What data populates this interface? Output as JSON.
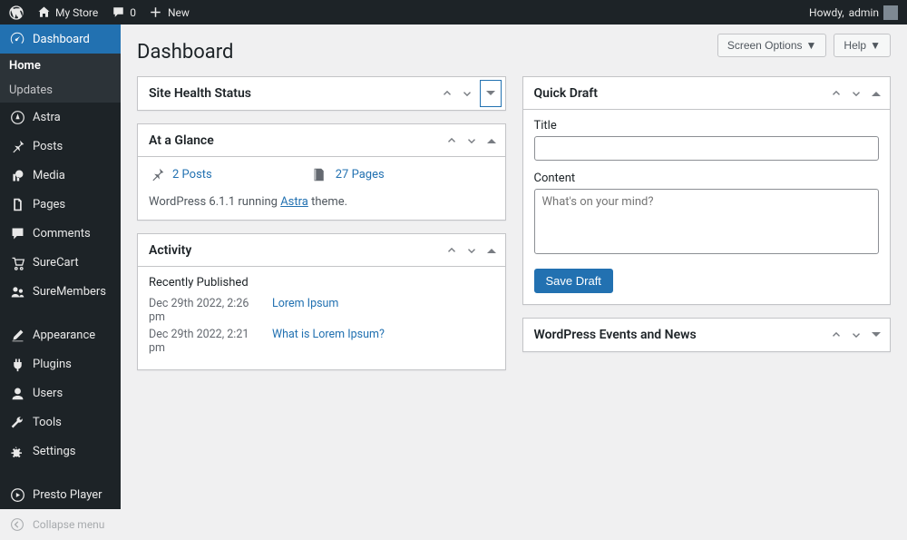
{
  "adminbar": {
    "site_name": "My Store",
    "comments_count": "0",
    "new_label": "New",
    "howdy_prefix": "Howdy, ",
    "username": "admin"
  },
  "sidebar": {
    "items": [
      {
        "label": "Dashboard"
      },
      {
        "label": "Astra"
      },
      {
        "label": "Posts"
      },
      {
        "label": "Media"
      },
      {
        "label": "Pages"
      },
      {
        "label": "Comments"
      },
      {
        "label": "SureCart"
      },
      {
        "label": "SureMembers"
      },
      {
        "label": "Appearance"
      },
      {
        "label": "Plugins"
      },
      {
        "label": "Users"
      },
      {
        "label": "Tools"
      },
      {
        "label": "Settings"
      },
      {
        "label": "Presto Player"
      }
    ],
    "submenu": [
      {
        "label": "Home"
      },
      {
        "label": "Updates"
      }
    ],
    "collapse_label": "Collapse menu"
  },
  "header": {
    "page_title": "Dashboard",
    "screen_options": "Screen Options",
    "help": "Help"
  },
  "site_health": {
    "title": "Site Health Status"
  },
  "glance": {
    "title": "At a Glance",
    "posts": "2 Posts",
    "pages": "27 Pages",
    "wp_prefix": "WordPress 6.1.1 running ",
    "theme_link": "Astra",
    "wp_suffix": " theme."
  },
  "activity": {
    "title": "Activity",
    "subtitle": "Recently Published",
    "rows": [
      {
        "date": "Dec 29th 2022, 2:26 pm",
        "link": "Lorem Ipsum"
      },
      {
        "date": "Dec 29th 2022, 2:21 pm",
        "link": "What is Lorem Ipsum?"
      }
    ]
  },
  "quickdraft": {
    "title": "Quick Draft",
    "title_label": "Title",
    "content_label": "Content",
    "content_placeholder": "What's on your mind?",
    "save_label": "Save Draft"
  },
  "events": {
    "title": "WordPress Events and News"
  }
}
